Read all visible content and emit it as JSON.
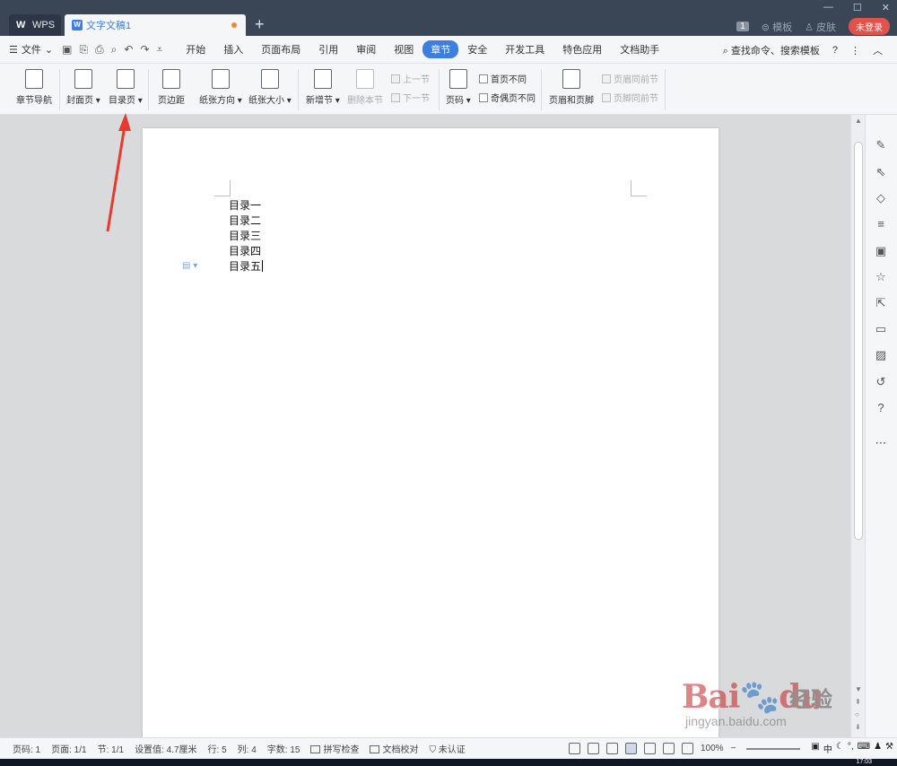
{
  "titlebar": {
    "app_tab": "WPS",
    "doc_tab": "文字文稿1",
    "new_tab": "+",
    "badge": "1",
    "template": "模板",
    "skin": "皮肤",
    "login": "未登录"
  },
  "menubar": {
    "file": "文件",
    "items": [
      "开始",
      "插入",
      "页面布局",
      "引用",
      "审阅",
      "视图",
      "章节",
      "安全",
      "开发工具",
      "特色应用",
      "文档助手"
    ],
    "active": "章节",
    "search": "查找命令、搜索模板",
    "help": "?"
  },
  "ribbon": {
    "chapter_nav": "章节导航",
    "cover": "封面页",
    "toc": "目录页",
    "margins": "页边距",
    "orientation": "纸张方向",
    "size": "纸张大小",
    "new_section": "新增节",
    "delete_section": "删除本节",
    "prev_section": "上一节",
    "next_section": "下一节",
    "page_num": "页码",
    "first_page_diff": "首页不同",
    "odd_even_diff": "奇偶页不同",
    "header_footer": "页眉和页脚",
    "header_same_prev": "页眉同前节",
    "footer_same_prev": "页脚同前节"
  },
  "document": {
    "lines": [
      "目录一",
      "目录二",
      "目录三",
      "目录四",
      "目录五"
    ]
  },
  "statusbar": {
    "page": "页码: 1",
    "pages": "页面: 1/1",
    "section": "节: 1/1",
    "setting": "设置值: 4.7厘米",
    "row": "行: 5",
    "col": "列: 4",
    "words": "字数: 15",
    "spell": "拼写检查",
    "proof": "文档校对",
    "auth": "未认证",
    "zoom": "100%",
    "ime_lang": "中"
  },
  "taskbar": {
    "clock": "17:03"
  },
  "watermark": {
    "logo": "Bai",
    "logo2": "du",
    "sub": "经验",
    "url": "jingyan.baidu.com"
  }
}
